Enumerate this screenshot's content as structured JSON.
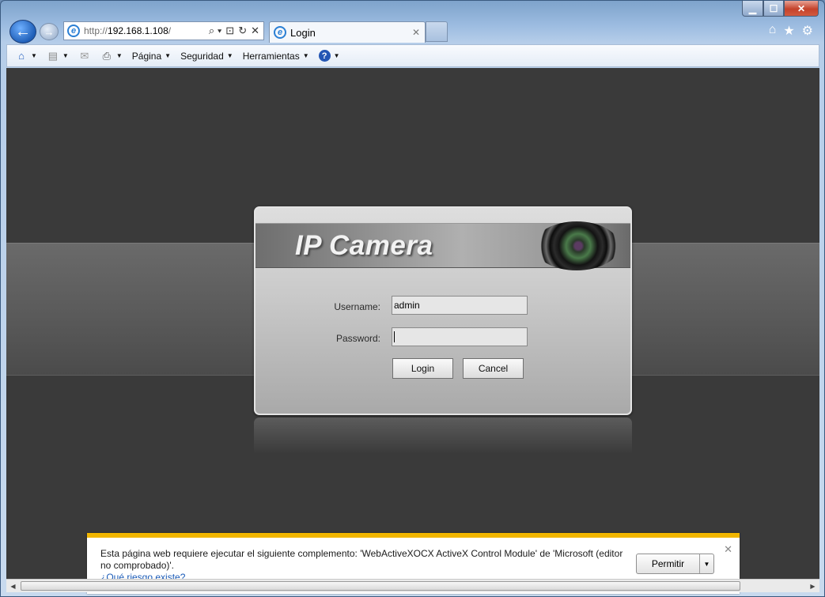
{
  "browser": {
    "window_controls": {
      "minimize": "▁",
      "maximize": "☐",
      "close": "✕"
    },
    "back_glyph": "←",
    "forward_glyph": "→",
    "address": {
      "scheme": "http://",
      "host": "192.168.1.108",
      "tail": "/"
    },
    "address_tools": [
      "⌕ ▾",
      "⊡",
      "↻",
      "✕"
    ],
    "tab": {
      "title": "Login",
      "close": "✕"
    },
    "right_icons": {
      "home": "⌂",
      "favorites": "★",
      "tools": "⚙"
    }
  },
  "command_bar": {
    "home_icon": "⌂",
    "feeds_icon": "▤",
    "mail_icon": "✉",
    "print_icon": "⎙",
    "menus": [
      "Página",
      "Seguridad",
      "Herramientas"
    ],
    "help_icon": "?",
    "caret": "▼"
  },
  "login": {
    "brand": "IP Camera",
    "username_label": "Username:",
    "username_value": "admin",
    "password_label": "Password:",
    "password_value": "",
    "login_button": "Login",
    "cancel_button": "Cancel"
  },
  "notification": {
    "message": "Esta página web requiere ejecutar el siguiente complemento: 'WebActiveXOCX ActiveX Control Module' de 'Microsoft (editor no comprobado)'.",
    "link": "¿Qué riesgo existe?",
    "allow_button": "Permitir",
    "dropdown": "▼",
    "close": "✕"
  },
  "scrollbar": {
    "left": "◀",
    "right": "▶"
  }
}
